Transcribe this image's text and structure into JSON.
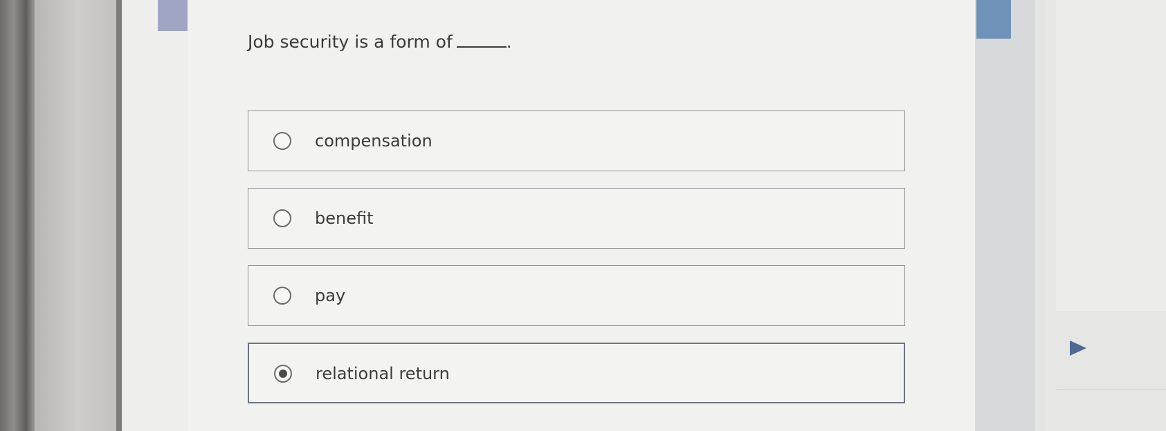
{
  "question": {
    "text": "Job security is a form of",
    "suffix": "."
  },
  "options": [
    {
      "label": "compensation",
      "selected": false
    },
    {
      "label": "benefit",
      "selected": false
    },
    {
      "label": "pay",
      "selected": false
    },
    {
      "label": "relational return",
      "selected": true
    }
  ],
  "colors": {
    "accent_blue": "#6f93b8",
    "accent_lavender": "#9fa6c3",
    "arrow": "#4e6a93"
  },
  "icons": {
    "next": "play-arrow-icon",
    "radio": "radio-icon"
  }
}
